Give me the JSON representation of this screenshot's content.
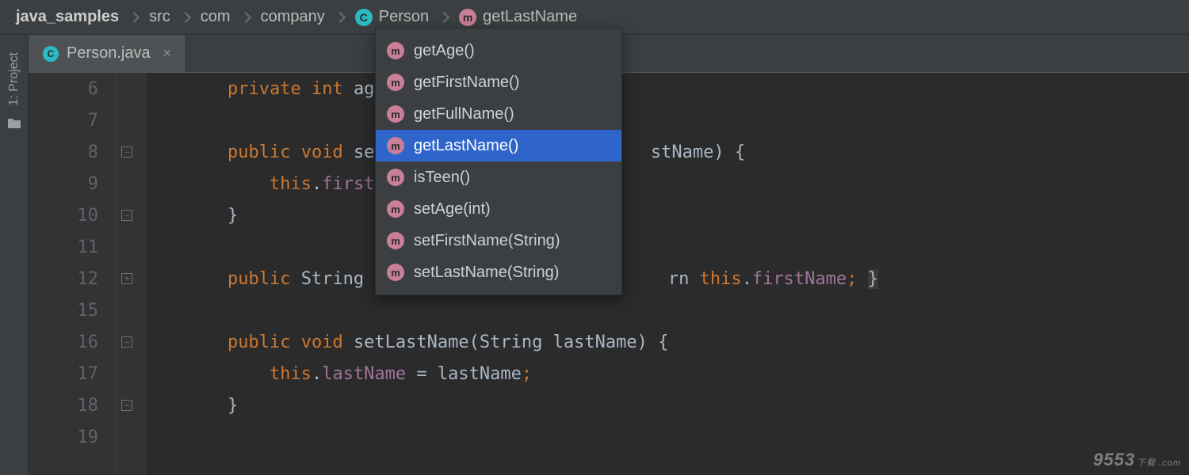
{
  "breadcrumb": {
    "items": [
      {
        "label": "java_samples"
      },
      {
        "label": "src"
      },
      {
        "label": "com"
      },
      {
        "label": "company"
      },
      {
        "label": "Person",
        "badge": "c"
      },
      {
        "label": "getLastName",
        "badge": "m"
      }
    ]
  },
  "toolstrip": {
    "project_label": "1: Project"
  },
  "tab": {
    "filename": "Person.java",
    "close": "×"
  },
  "gutter": {
    "start": 6,
    "numbers": [
      "6",
      "7",
      "8",
      "9",
      "10",
      "11",
      "12",
      "15",
      "16",
      "17",
      "18",
      "19"
    ]
  },
  "code": {
    "l6": {
      "indent": "    ",
      "kw1": "private ",
      "kw2": "int ",
      "id": "age",
      "semi": ";"
    },
    "l8a": {
      "indent": "    ",
      "kw1": "public ",
      "kw2": "void ",
      "id": "setF"
    },
    "l8b": {
      "textA": "stName) ",
      "brace": "{"
    },
    "l9": {
      "indent": "        ",
      "kw": "this",
      "dot": ".",
      "field": "firstN"
    },
    "l10": {
      "indent": "    ",
      "brace": "}"
    },
    "l12a": {
      "indent": "    ",
      "kw1": "public ",
      "type": "String ",
      "id": "ge"
    },
    "l12b": {
      "textA": "rn ",
      "kw": "this",
      "dot": ".",
      "field": "firstName",
      "semi": ";",
      "sp": " ",
      "brace": "}"
    },
    "l16": {
      "indent": "    ",
      "kw1": "public ",
      "kw2": "void ",
      "id": "setLastName",
      "paren": "(",
      "type": "String ",
      "param": "lastName",
      "parenC": ") ",
      "brace": "{"
    },
    "l17": {
      "indent": "        ",
      "kw": "this",
      "dot": ".",
      "field": "lastName",
      "eq": " = ",
      "rhs": "lastName",
      "semi": ";"
    },
    "l18": {
      "indent": "    ",
      "brace": "}"
    }
  },
  "dropdown": {
    "items": [
      {
        "label": "getAge()",
        "selected": false
      },
      {
        "label": "getFirstName()",
        "selected": false
      },
      {
        "label": "getFullName()",
        "selected": false
      },
      {
        "label": "getLastName()",
        "selected": true
      },
      {
        "label": "isTeen()",
        "selected": false
      },
      {
        "label": "setAge(int)",
        "selected": false
      },
      {
        "label": "setFirstName(String)",
        "selected": false
      },
      {
        "label": "setLastName(String)",
        "selected": false
      }
    ]
  },
  "watermark": {
    "text": "9553",
    "suffix": "下载\n.com"
  }
}
